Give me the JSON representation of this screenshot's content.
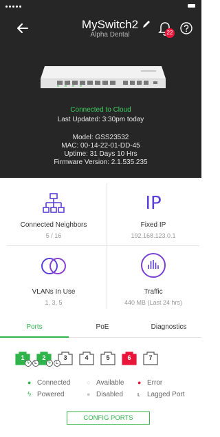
{
  "header": {
    "title": "MySwitch2",
    "subtitle": "Alpha Dental",
    "notification_count": "22"
  },
  "device": {
    "cloud_status": "Connected to Cloud",
    "last_updated": "Last Updated: 3:30pm today",
    "model": "Model: GSS23532",
    "mac": "MAC: 00-14-22-01-DD-45",
    "uptime": "Uptime: 31 Days 10 Hrs",
    "firmware": "Firmware Version: 2.1.535.235"
  },
  "tiles": [
    {
      "label": "Connected Neighbors",
      "value": "5 / 16",
      "icon": "network-icon"
    },
    {
      "label": "Fixed IP",
      "value": "192.168.123.0.1",
      "icon_text": "IP"
    },
    {
      "label": "VLANs In Use",
      "value": "1, 3, 5",
      "icon": "vlan-circles-icon"
    },
    {
      "label": "Traffic",
      "value": "440 MB (Last 24 hrs)",
      "icon": "traffic-bars-icon"
    }
  ],
  "tabs": [
    {
      "label": "Ports",
      "active": true
    },
    {
      "label": "PoE",
      "active": false
    },
    {
      "label": "Diagnostics",
      "active": false
    }
  ],
  "ports": [
    {
      "num": "1",
      "state": "connected",
      "powered": true,
      "lagged": false
    },
    {
      "num": "2",
      "state": "connected",
      "powered": true,
      "lagged": true
    },
    {
      "num": "3",
      "state": "available",
      "powered": false,
      "lagged": true
    },
    {
      "num": "4",
      "state": "available",
      "powered": false,
      "lagged": false
    },
    {
      "num": "5",
      "state": "available",
      "powered": false,
      "lagged": false
    },
    {
      "num": "6",
      "state": "error",
      "powered": false,
      "lagged": false
    },
    {
      "num": "7",
      "state": "available",
      "powered": false,
      "lagged": false
    }
  ],
  "legend": {
    "connected": "Connected",
    "available": "Available",
    "error": "Error",
    "powered": "Powered",
    "disabled": "Disabled",
    "lagged": "Lagged Port"
  },
  "config_button": "CONFIG PORTS",
  "colors": {
    "green": "#2fb34b",
    "error": "#e8163b",
    "purple": "#5b3fd9",
    "header_bg": "#262626"
  }
}
